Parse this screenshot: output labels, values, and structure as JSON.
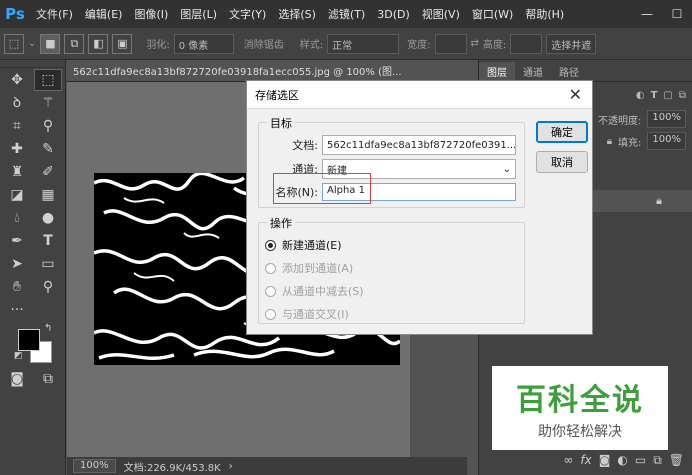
{
  "menubar": {
    "logo": "Ps",
    "items": [
      "文件(F)",
      "编辑(E)",
      "图像(I)",
      "图层(L)",
      "文字(Y)",
      "选择(S)",
      "滤镜(T)",
      "3D(D)",
      "视图(V)",
      "窗口(W)",
      "帮助(H)"
    ]
  },
  "optbar": {
    "feather_label": "羽化:",
    "feather_value": "0 像素",
    "antialias_label": "消除锯齿",
    "style_label": "样式:",
    "style_value": "正常",
    "width_label": "宽度:",
    "height_label": "高度:",
    "select_mask_label": "选择并遮"
  },
  "document": {
    "tab_title": "562c11dfa9ec8a13bf872720fe03918fa1ecc055.jpg @ 100% (图...",
    "zoom": "100%",
    "doc_info": "文档:226.9K/453.8K"
  },
  "right_panel": {
    "tabs": [
      "图层",
      "通道",
      "路径"
    ],
    "opacity_label": "不透明度:",
    "opacity_value": "100%",
    "fill_label": "填充:",
    "fill_value": "100%"
  },
  "dialog": {
    "title": "存储选区",
    "target_group": "目标",
    "document_label": "文档:",
    "document_value": "562c11dfa9ec8a13bf872720fe0391...",
    "channel_label": "通道:",
    "channel_value": "新建",
    "name_label": "名称(N):",
    "name_value": "Alpha 1",
    "operation_group": "操作",
    "operations": [
      {
        "label": "新建通道(E)",
        "checked": true,
        "enabled": true
      },
      {
        "label": "添加到通道(A)",
        "checked": false,
        "enabled": false
      },
      {
        "label": "从通道中减去(S)",
        "checked": false,
        "enabled": false
      },
      {
        "label": "与通道交叉(I)",
        "checked": false,
        "enabled": false
      }
    ],
    "ok_label": "确定",
    "cancel_label": "取消"
  },
  "watermark": {
    "title": "百科全说",
    "subtitle": "助你轻松解决"
  },
  "colors": {
    "ps_blue": "#31a8ff",
    "highlight_red": "#e0403a",
    "watermark_green": "#3d9e3b"
  }
}
